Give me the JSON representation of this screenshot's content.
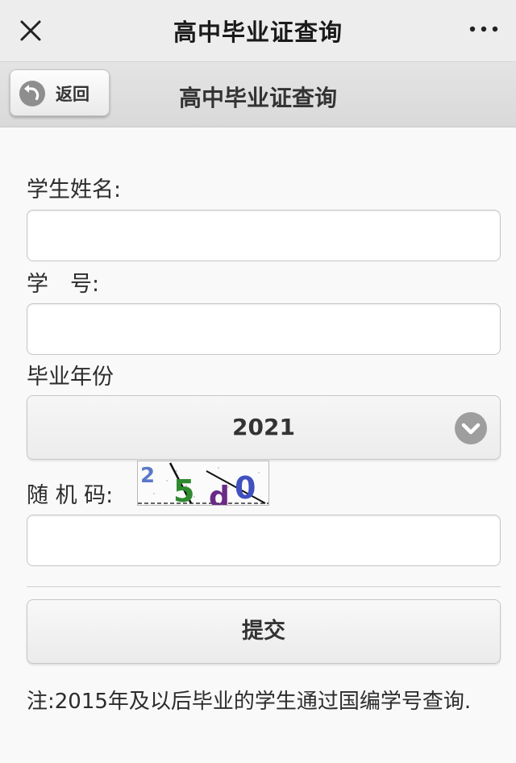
{
  "topbar": {
    "title": "高中毕业证查询",
    "close_icon": "close-icon",
    "more_icon": "more-icon"
  },
  "navbar": {
    "back_label": "返回",
    "back_icon": "back-arrow-icon",
    "title": "高中毕业证查询"
  },
  "form": {
    "name_label": "学生姓名:",
    "name_value": "",
    "id_label": "学　号:",
    "id_value": "",
    "year_label": "毕业年份",
    "year_value": "2021",
    "captcha_label": "随 机 码:",
    "captcha_text": "25d0",
    "captcha_value": "",
    "submit_label": "提交"
  },
  "note": "注:2015年及以后毕业的学生通过国编学号查询.",
  "colors": {
    "topbar_bg": "#ededed",
    "navbar_bg": "#dddddd",
    "chevron_bg": "#9e9e9e"
  }
}
